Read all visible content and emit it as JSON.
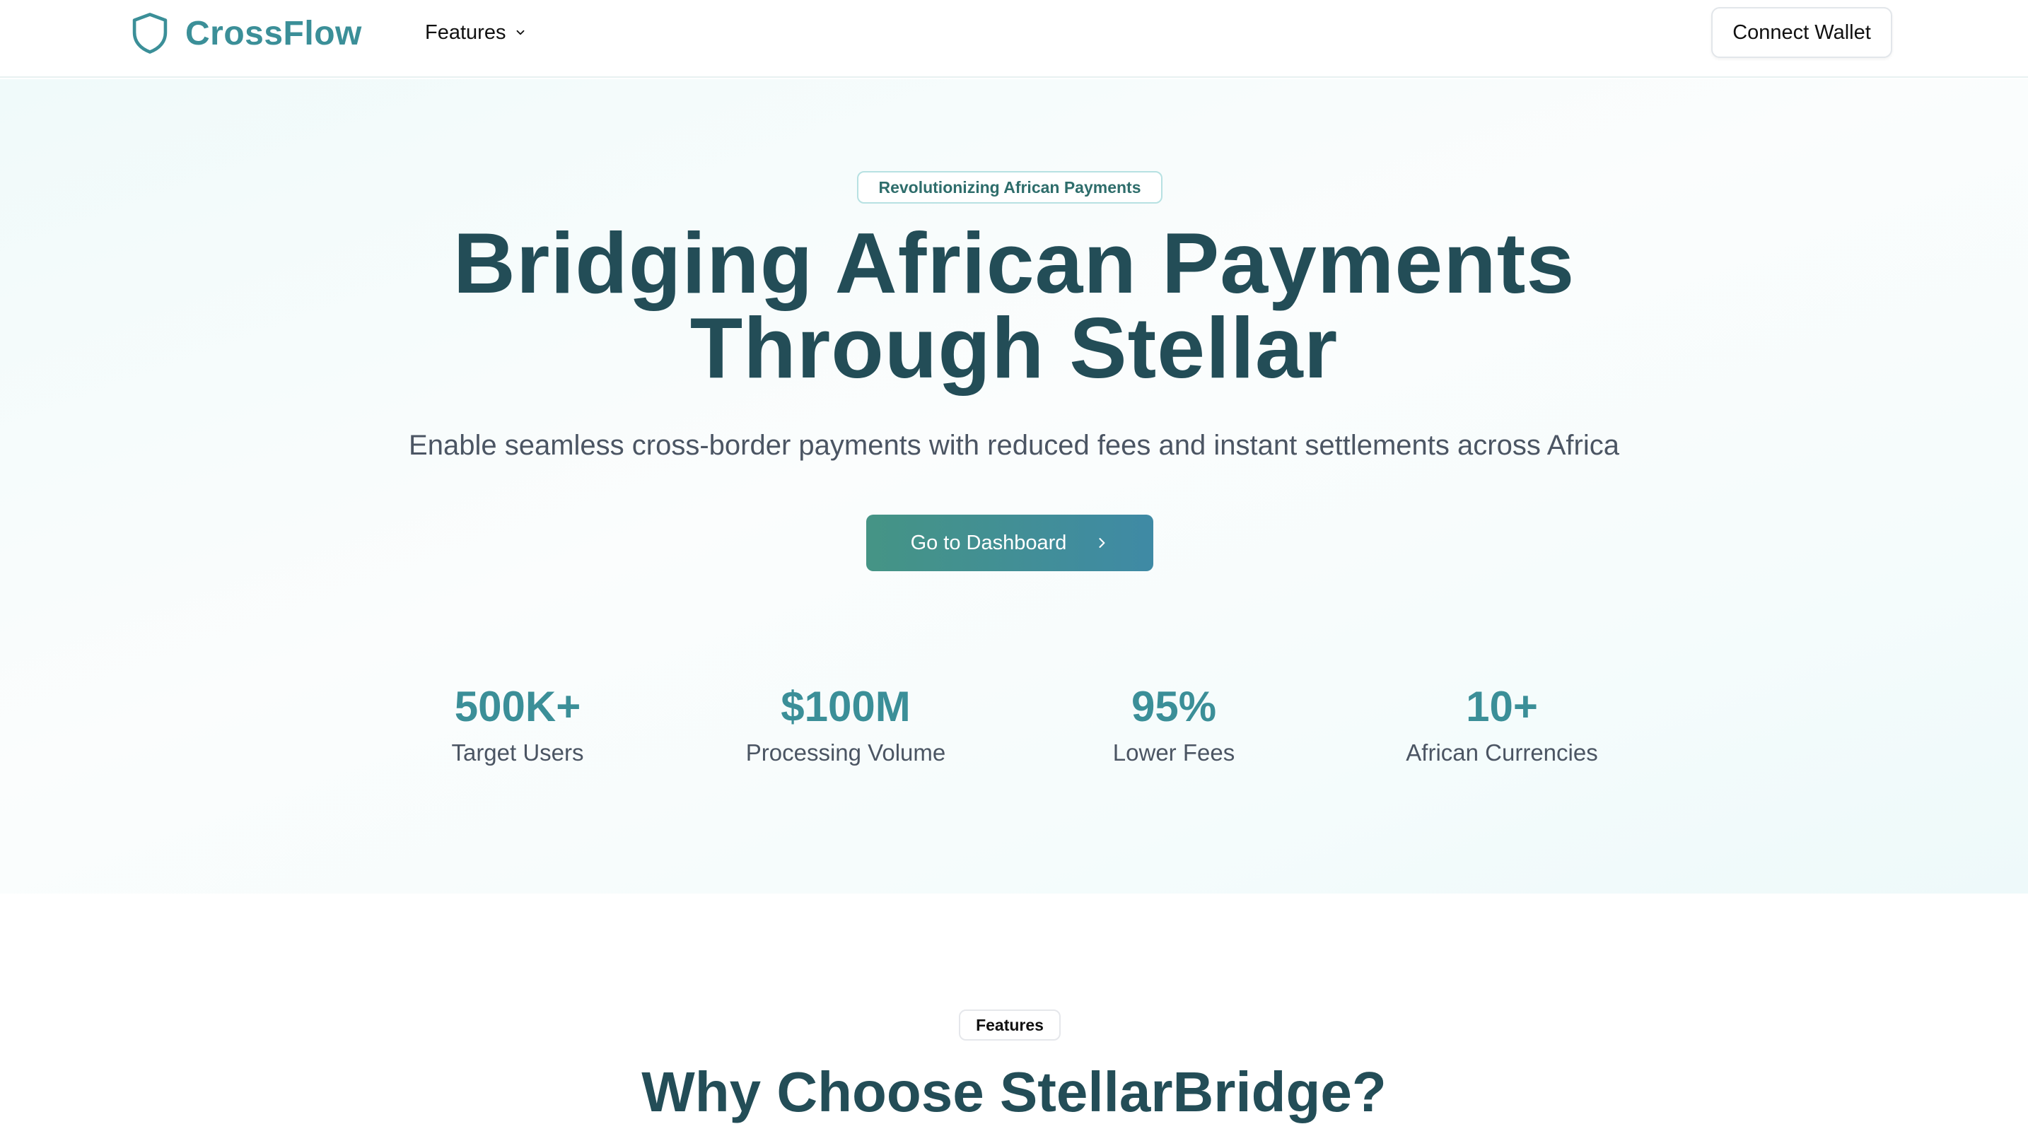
{
  "brand": {
    "name": "CrossFlow",
    "icon": "shield-icon",
    "color": "#3b8f98"
  },
  "nav": {
    "features_label": "Features",
    "connect_wallet_label": "Connect Wallet"
  },
  "hero": {
    "badge": "Revolutionizing African Payments",
    "title_line1": "Bridging African Payments",
    "title_line2": "Through Stellar",
    "subtitle": "Enable seamless cross-border payments with reduced fees and instant settlements across Africa",
    "cta_label": "Go to Dashboard"
  },
  "stats": [
    {
      "value": "500K+",
      "label": "Target Users"
    },
    {
      "value": "$100M",
      "label": "Processing Volume"
    },
    {
      "value": "95%",
      "label": "Lower Fees"
    },
    {
      "value": "10+",
      "label": "African Currencies"
    }
  ],
  "features": {
    "badge": "Features",
    "title": "Why Choose StellarBridge?"
  },
  "colors": {
    "accent": "#3b8f98",
    "heading": "#234d57",
    "cta_gradient_start": "#459485",
    "cta_gradient_end": "#3f8aa5"
  }
}
